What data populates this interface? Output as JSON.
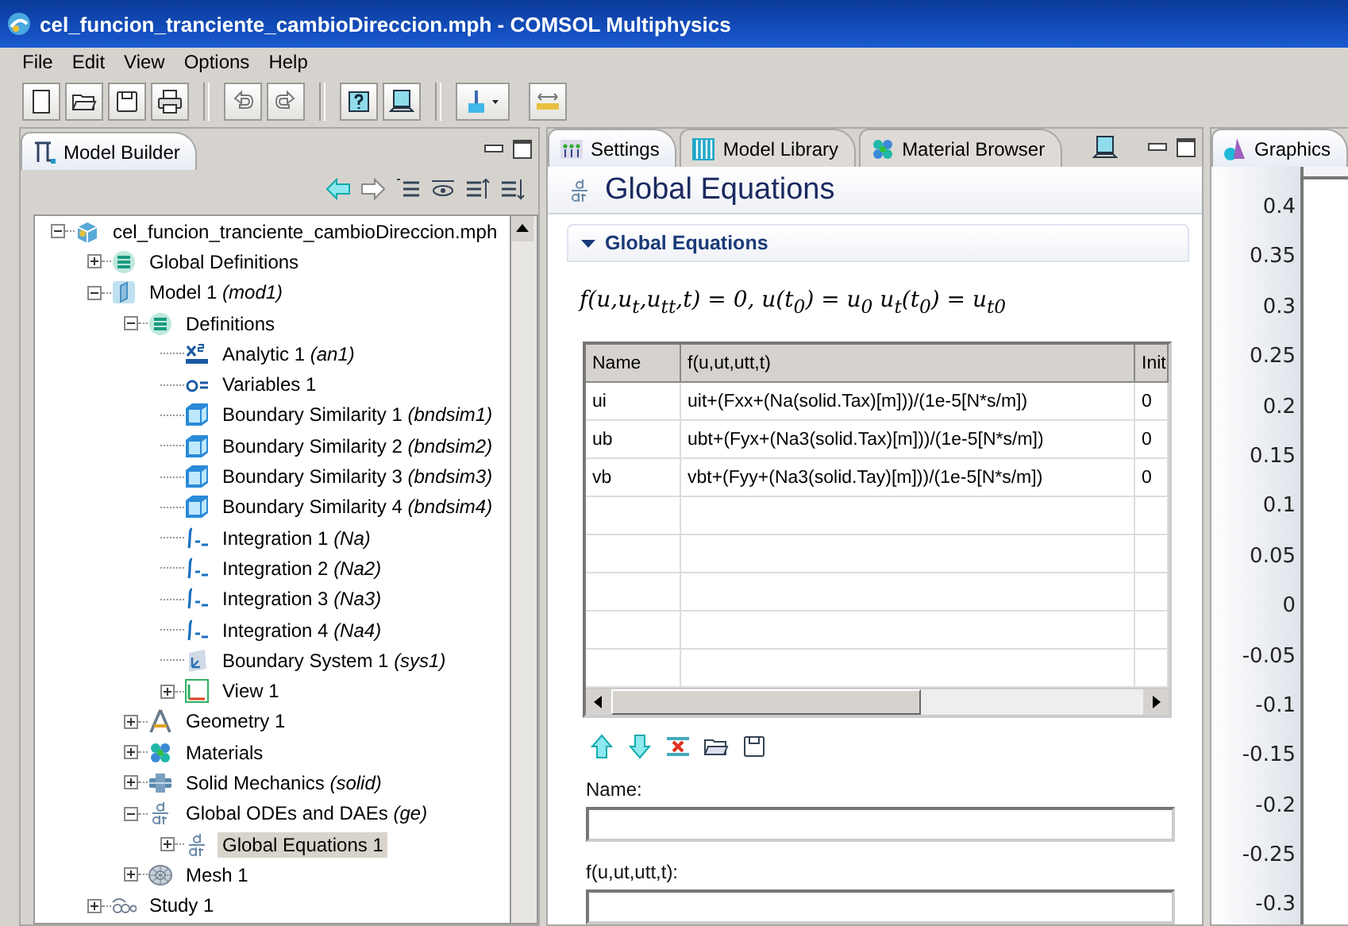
{
  "window": {
    "title": "cel_funcion_tranciente_cambioDireccion.mph - COMSOL Multiphysics"
  },
  "menu": [
    "File",
    "Edit",
    "View",
    "Options",
    "Help"
  ],
  "model_builder": {
    "tab": {
      "label": "Model Builder",
      "selected": true
    },
    "tree": [
      {
        "label": "cel_funcion_tranciente_cambioDireccion.mph",
        "kind": "file",
        "expanded": true,
        "selected": false,
        "children": [
          {
            "label": "Global Definitions",
            "kind": "definitions",
            "expanded": false,
            "selected": false
          },
          {
            "label": "Model 1",
            "tag": "(mod1)",
            "kind": "model",
            "expanded": true,
            "selected": false,
            "children": [
              {
                "label": "Definitions",
                "kind": "definitions",
                "expanded": true,
                "selected": false,
                "children": [
                  {
                    "label": "Analytic 1",
                    "tag": "(an1)",
                    "kind": "analytic",
                    "selected": false
                  },
                  {
                    "label": "Variables 1",
                    "kind": "variables",
                    "selected": false
                  },
                  {
                    "label": "Boundary Similarity 1",
                    "tag": "(bndsim1)",
                    "kind": "similarity",
                    "selected": false
                  },
                  {
                    "label": "Boundary Similarity 2",
                    "tag": "(bndsim2)",
                    "kind": "similarity",
                    "selected": false
                  },
                  {
                    "label": "Boundary Similarity 3",
                    "tag": "(bndsim3)",
                    "kind": "similarity",
                    "selected": false
                  },
                  {
                    "label": "Boundary Similarity 4",
                    "tag": "(bndsim4)",
                    "kind": "similarity",
                    "selected": false
                  },
                  {
                    "label": "Integration 1",
                    "tag": "(Na)",
                    "kind": "integration",
                    "selected": false
                  },
                  {
                    "label": "Integration 2",
                    "tag": "(Na2)",
                    "kind": "integration",
                    "selected": false
                  },
                  {
                    "label": "Integration 3",
                    "tag": "(Na3)",
                    "kind": "integration",
                    "selected": false
                  },
                  {
                    "label": "Integration 4",
                    "tag": "(Na4)",
                    "kind": "integration",
                    "selected": false
                  },
                  {
                    "label": "Boundary System 1",
                    "tag": "(sys1)",
                    "kind": "system",
                    "selected": false
                  },
                  {
                    "label": "View 1",
                    "kind": "view",
                    "expanded": false,
                    "selected": false
                  }
                ]
              },
              {
                "label": "Geometry 1",
                "kind": "geometry",
                "expanded": false,
                "selected": false
              },
              {
                "label": "Materials",
                "kind": "materials",
                "expanded": false,
                "selected": false
              },
              {
                "label": "Solid Mechanics",
                "tag": "(solid)",
                "kind": "physics",
                "expanded": false,
                "selected": false
              },
              {
                "label": "Global ODEs and DAEs",
                "tag": "(ge)",
                "kind": "ode",
                "expanded": true,
                "selected": false,
                "children": [
                  {
                    "label": "Global Equations 1",
                    "kind": "ode",
                    "expanded": false,
                    "selected": true
                  }
                ]
              },
              {
                "label": "Mesh 1",
                "kind": "mesh",
                "expanded": false,
                "selected": false
              }
            ]
          },
          {
            "label": "Study 1",
            "kind": "study",
            "expanded": false,
            "selected": false
          }
        ]
      }
    ]
  },
  "settings": {
    "tabs": [
      {
        "label": "Settings",
        "kind": "settings",
        "selected": true
      },
      {
        "label": "Model Library",
        "kind": "library",
        "selected": false
      },
      {
        "label": "Material Browser",
        "kind": "materials",
        "selected": false
      }
    ],
    "title": "Global Equations",
    "section": {
      "title": "Global Equations",
      "expanded": true
    },
    "equation": "f(u,u$_{t}$,u$_{tt}$,t) = 0,  u(t$_{0}$) = u$_{0}$  u$_{t}$(t$_{0}$) = u$_{t0}$",
    "table": {
      "columns": [
        "Name",
        "f(u,ut,utt,t)",
        "Init"
      ],
      "rows": [
        [
          "ui",
          "uit+(Fxx+(Na(solid.Tax)[m]))/(1e-5[N*s/m])",
          "0"
        ],
        [
          "ub",
          "ubt+(Fyx+(Na3(solid.Tax)[m]))/(1e-5[N*s/m])",
          "0"
        ],
        [
          "vb",
          "vbt+(Fyy+(Na3(solid.Tay)[m]))/(1e-5[N*s/m])",
          "0"
        ]
      ]
    },
    "fields": [
      {
        "label": "Name:"
      },
      {
        "label": "f(u,ut,utt,t):"
      }
    ]
  },
  "graphics": {
    "tab": {
      "label": "Graphics",
      "selected": true
    },
    "axis_labels": [
      "0.4",
      "0.35",
      "0.3",
      "0.25",
      "0.2",
      "0.15",
      "0.1",
      "0.05",
      "0",
      "-0.05",
      "-0.1",
      "-0.15",
      "-0.2",
      "-0.25",
      "-0.3"
    ]
  }
}
